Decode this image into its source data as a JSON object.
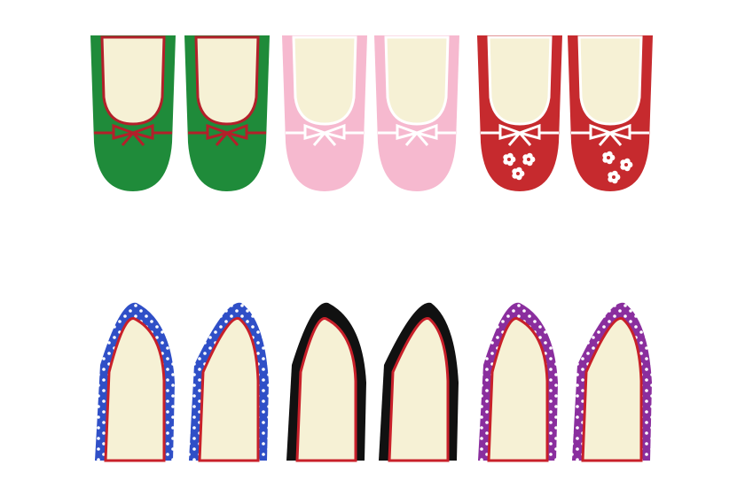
{
  "image": {
    "subject": "ballet flats",
    "background": "#ffffff"
  },
  "top_row": [
    {
      "id": "green",
      "body": "#1f8b3a",
      "trim": "#b3202a",
      "bow": "#b3202a",
      "decor": "none"
    },
    {
      "id": "pink",
      "body": "#f6b9cf",
      "trim": "#ffffff",
      "bow": "#ffffff",
      "decor": "none"
    },
    {
      "id": "red",
      "body": "#c62a2e",
      "trim": "#ffffff",
      "bow": "#ffffff",
      "decor": "flowers"
    }
  ],
  "bottom_row": [
    {
      "id": "blue-dots",
      "body": "#2f4fc7",
      "trim": "#c8202a",
      "decor": "polka-dots"
    },
    {
      "id": "black",
      "body": "#111111",
      "trim": "#c8202a",
      "decor": "none"
    },
    {
      "id": "purple-dots",
      "body": "#8a2e9e",
      "trim": "#c8202a",
      "decor": "polka-dots"
    }
  ],
  "insole": "#f6f1d5"
}
